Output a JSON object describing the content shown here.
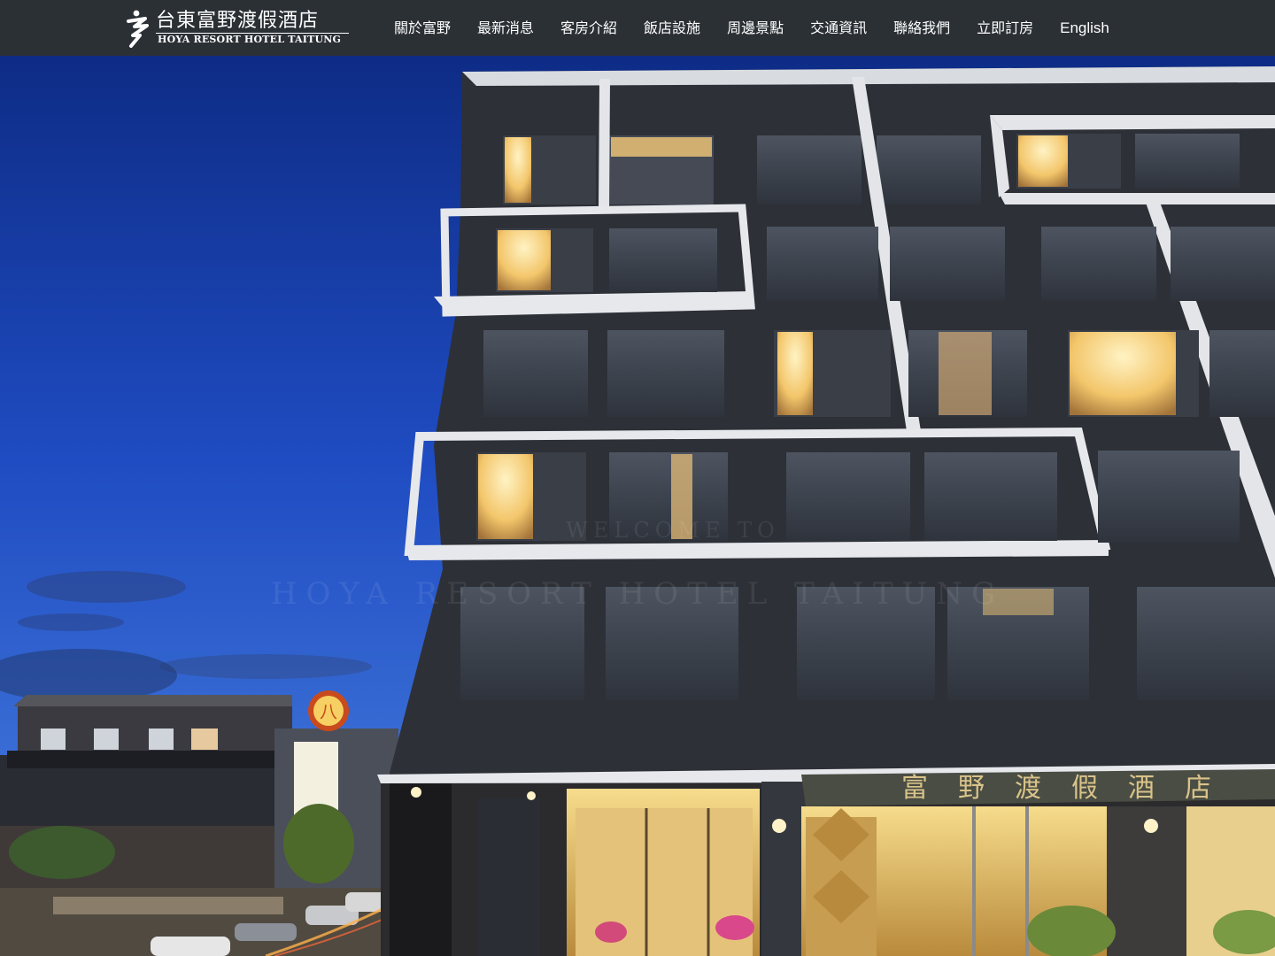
{
  "header": {
    "logo": {
      "name_zh": "台東富野渡假酒店",
      "name_en": "HOYA RESORT HOTEL TAITUNG"
    },
    "menu": [
      {
        "label": "關於富野"
      },
      {
        "label": "最新消息"
      },
      {
        "label": "客房介紹"
      },
      {
        "label": "飯店設施"
      },
      {
        "label": "周邊景點"
      },
      {
        "label": "交通資訊"
      },
      {
        "label": "聯絡我們"
      },
      {
        "label": "立即訂房"
      },
      {
        "label": "English"
      }
    ]
  },
  "hero": {
    "watermark_line1": "WELCOME TO",
    "watermark_line2": "HOYA RESORT HOTEL TAITUNG",
    "facade_sign": "富野渡假酒店",
    "roadside_sign": "八",
    "colors": {
      "sky_top": "#0f2f8a",
      "sky_bottom": "#3a6fd8",
      "facade": "#2c2f36",
      "window_glow": "#ffd98a",
      "navbar": "#2b3035"
    }
  }
}
